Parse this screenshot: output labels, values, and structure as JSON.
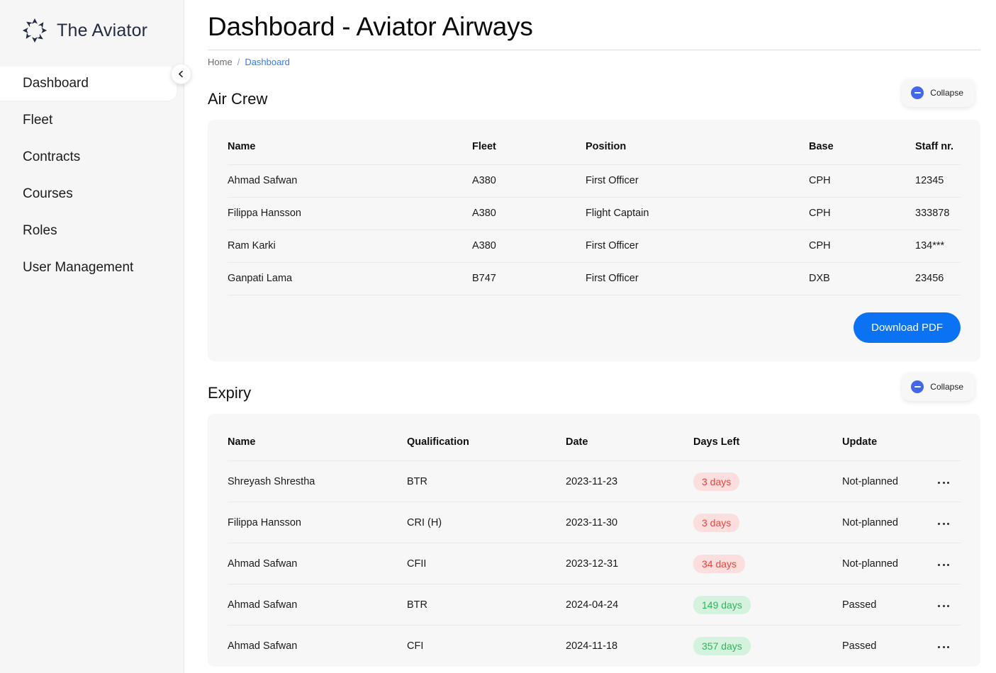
{
  "brand": {
    "name": "The Aviator",
    "logo_icon": "aviator-star-logo"
  },
  "sidebar": {
    "toggle_icon": "chevron-left-icon",
    "items": [
      {
        "label": "Dashboard",
        "active": true
      },
      {
        "label": "Fleet",
        "active": false
      },
      {
        "label": "Contracts",
        "active": false
      },
      {
        "label": "Courses",
        "active": false
      },
      {
        "label": "Roles",
        "active": false
      },
      {
        "label": "User Management",
        "active": false
      }
    ]
  },
  "header": {
    "title": "Dashboard - Aviator Airways",
    "breadcrumb": {
      "home": "Home",
      "separator": "/",
      "current": "Dashboard"
    }
  },
  "colors": {
    "accent_blue": "#0b72f4",
    "collapse_blue": "#4267e8",
    "link_blue": "#2f7df6",
    "badge_red_text": "#e8443c",
    "badge_red_bg": "#fbdedd",
    "badge_green_text": "#31b35c",
    "badge_green_bg": "#d4f2dd",
    "card_bg": "#f7f7f8",
    "sidebar_bg": "#f6f6f7"
  },
  "air_crew": {
    "title": "Air Crew",
    "collapse_label": "Collapse",
    "collapse_icon": "minus-circle-icon",
    "columns": [
      "Name",
      "Fleet",
      "Position",
      "Base",
      "Staff nr."
    ],
    "rows": [
      {
        "name": "Ahmad Safwan",
        "fleet": "A380",
        "position": "First Officer",
        "base": "CPH",
        "staff_nr": "12345"
      },
      {
        "name": "Filippa Hansson",
        "fleet": "A380",
        "position": "Flight Captain",
        "base": "CPH",
        "staff_nr": "333878"
      },
      {
        "name": "Ram Karki",
        "fleet": "A380",
        "position": "First Officer",
        "base": "CPH",
        "staff_nr": "134***"
      },
      {
        "name": "Ganpati Lama",
        "fleet": "B747",
        "position": "First Officer",
        "base": "DXB",
        "staff_nr": "23456"
      }
    ],
    "download_button": "Download PDF"
  },
  "expiry": {
    "title": "Expiry",
    "collapse_label": "Collapse",
    "collapse_icon": "minus-circle-icon",
    "columns": [
      "Name",
      "Qualification",
      "Date",
      "Days Left",
      "Update"
    ],
    "menu_icon": "more-horizontal-icon",
    "rows": [
      {
        "name": "Shreyash Shrestha",
        "qualification": "BTR",
        "date": "2023-11-23",
        "days_left": "3 days",
        "status": "red",
        "update": "Not-planned"
      },
      {
        "name": "Filippa Hansson",
        "qualification": "CRI (H)",
        "date": "2023-11-30",
        "days_left": "3 days",
        "status": "red",
        "update": "Not-planned"
      },
      {
        "name": "Ahmad Safwan",
        "qualification": "CFII",
        "date": "2023-12-31",
        "days_left": "34 days",
        "status": "red",
        "update": "Not-planned"
      },
      {
        "name": "Ahmad Safwan",
        "qualification": "BTR",
        "date": "2024-04-24",
        "days_left": "149 days",
        "status": "green",
        "update": "Passed"
      },
      {
        "name": "Ahmad Safwan",
        "qualification": "CFI",
        "date": "2024-11-18",
        "days_left": "357 days",
        "status": "green",
        "update": "Passed"
      }
    ]
  }
}
